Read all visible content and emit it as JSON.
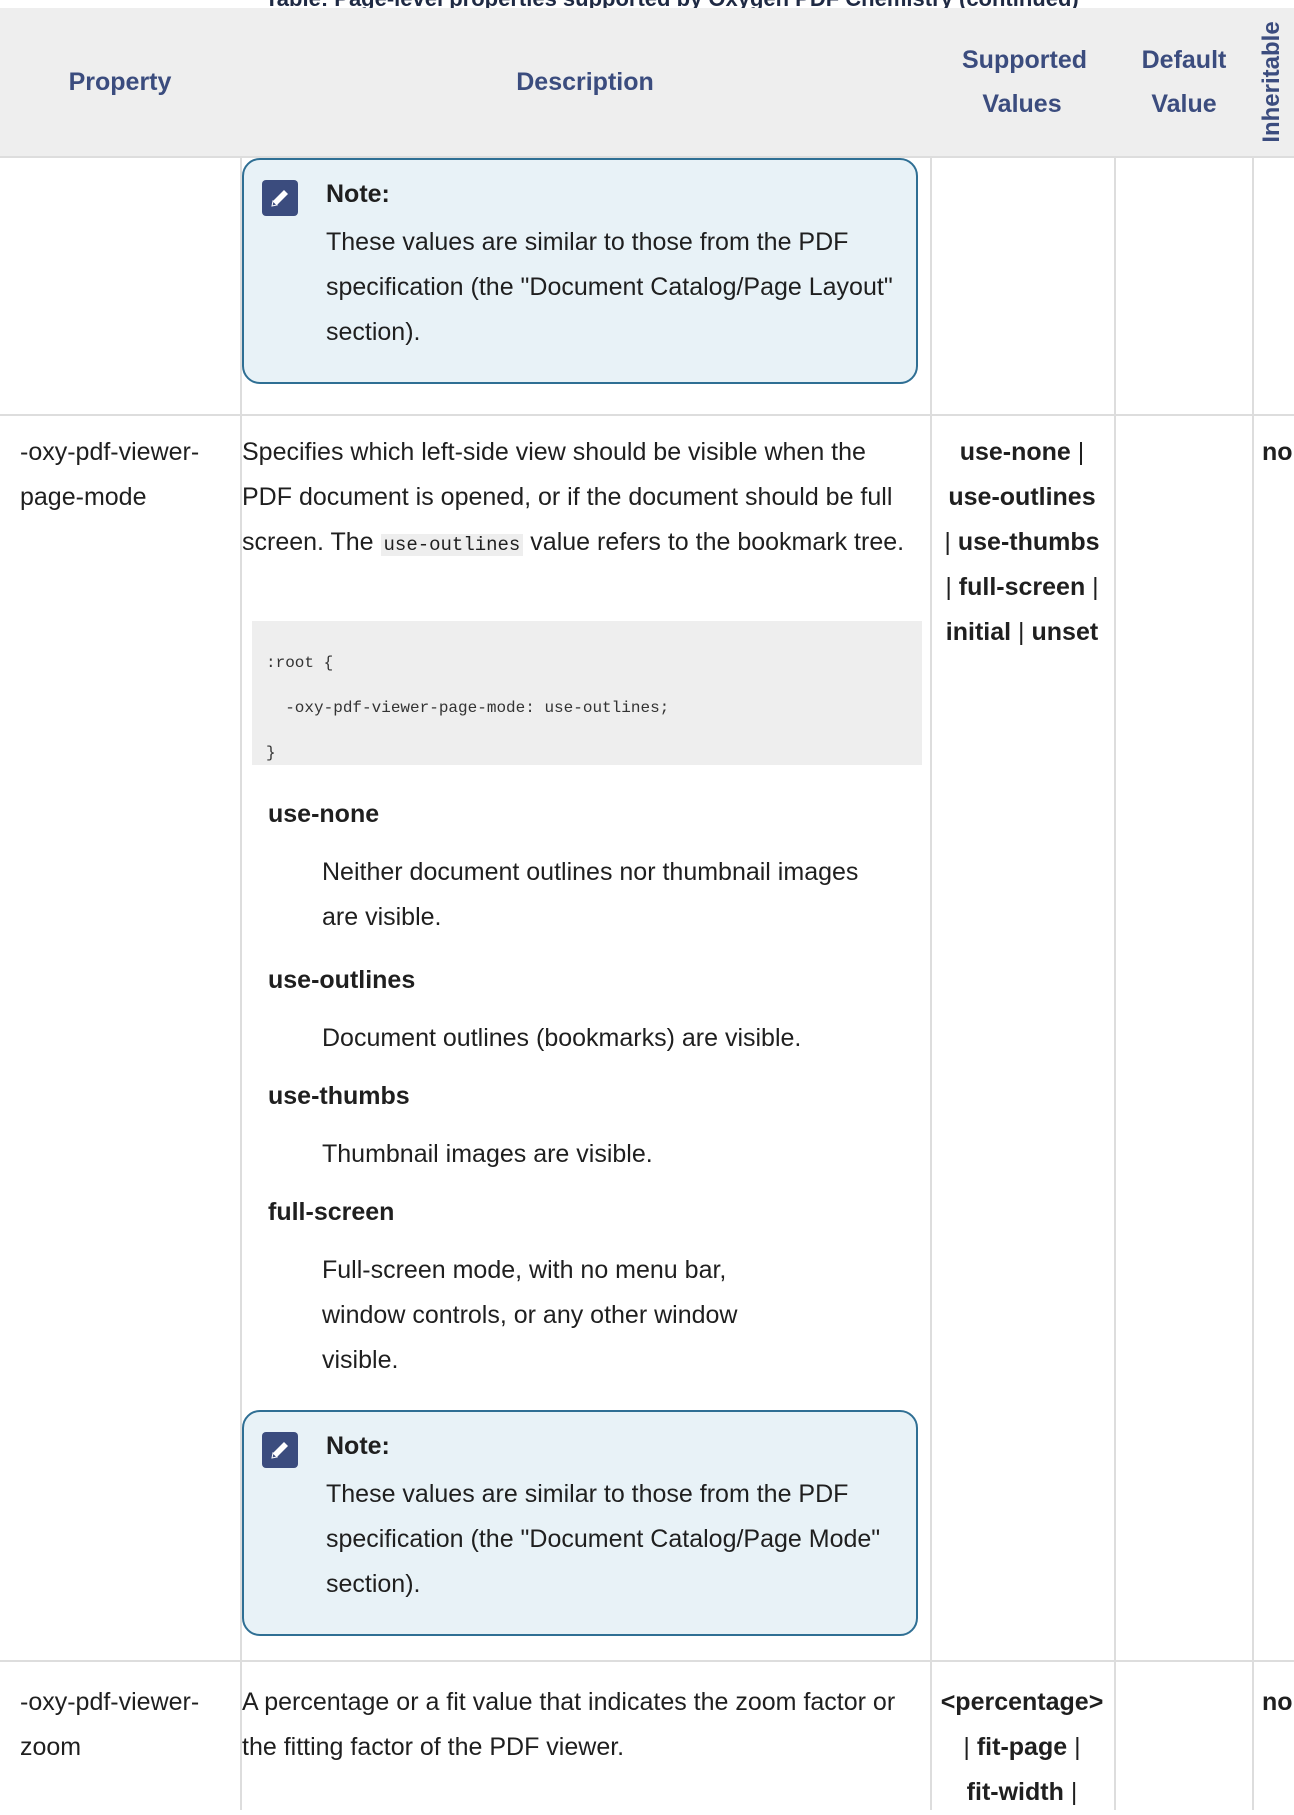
{
  "table": {
    "caption": "Table: Page-level properties supported by Oxygen PDF Chemistry (continued)",
    "headers": {
      "property": "Property",
      "description": "Description",
      "supported_values": "Supported Values",
      "default_value": "Default Value",
      "inheritable": "Inheritable"
    },
    "top_note": {
      "title": "Note:",
      "text": "These values are similar to those from the PDF specification (the \"Document Catalog/Page Layout\" section)."
    },
    "rows": [
      {
        "property": "-oxy-pdf-viewer-page-mode",
        "description_before": "Specifies which left-side view should be visible when the PDF document is opened, or if the document should be full screen. The ",
        "description_code": "use-outlines",
        "description_after": " value refers to the bookmark tree.",
        "code_lines": [
          ":root {",
          "  -oxy-pdf-viewer-page-mode: use-outlines;",
          "}"
        ],
        "values": [
          "use-none",
          "use-outlines",
          "use-thumbs",
          "full-screen",
          "initial",
          "unset"
        ],
        "value_separator": "|",
        "inheritable": "no",
        "definitions": [
          {
            "term": "use-none",
            "text": "Neither document outlines nor thumbnail images are visible."
          },
          {
            "term": "use-outlines",
            "text": "Document outlines (bookmarks) are visible."
          },
          {
            "term": "use-thumbs",
            "text": "Thumbnail images are visible."
          },
          {
            "term": "full-screen",
            "text": "Full-screen mode, with no menu bar, window controls, or any other window visible."
          }
        ],
        "note": {
          "title": "Note:",
          "text": "These values are similar to those from the PDF specification (the \"Document Catalog/Page Mode\" section)."
        }
      },
      {
        "property": "-oxy-pdf-viewer-zoom",
        "description": "A percentage or a fit value that indicates the zoom factor or the fitting factor of the PDF viewer.",
        "values": [
          "<percentage>",
          "fit-page",
          "fit-width"
        ],
        "value_separator": "|",
        "inheritable": "no"
      }
    ]
  },
  "colors": {
    "header_text": "#3b4c7e",
    "header_bg": "#eeeeee",
    "note_border": "#2f6f94",
    "note_bg": "#e8f2f7",
    "code_bg": "#eeeeee"
  }
}
